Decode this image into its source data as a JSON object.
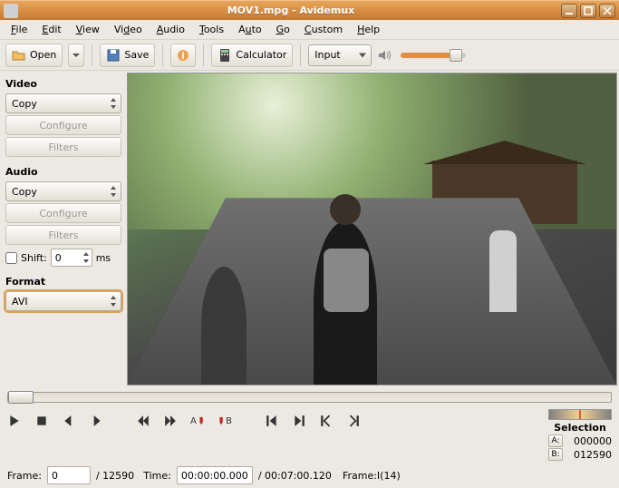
{
  "titlebar": {
    "title": "MOV1.mpg - Avidemux"
  },
  "menu": {
    "file": "File",
    "edit": "Edit",
    "view": "View",
    "video": "Video",
    "audio": "Audio",
    "tools": "Tools",
    "auto": "Auto",
    "go": "Go",
    "custom": "Custom",
    "help": "Help"
  },
  "toolbar": {
    "open": "Open",
    "save": "Save",
    "calculator": "Calculator",
    "input": "Input"
  },
  "sidebar": {
    "video_h": "Video",
    "video_codec": "Copy",
    "video_configure": "Configure",
    "video_filters": "Filters",
    "audio_h": "Audio",
    "audio_codec": "Copy",
    "audio_configure": "Configure",
    "audio_filters": "Filters",
    "shift_label": "Shift:",
    "shift_value": "0",
    "shift_unit": "ms",
    "format_h": "Format",
    "format": "AVI"
  },
  "selection": {
    "heading": "Selection",
    "a_label": "A:",
    "a_value": "000000",
    "b_label": "B:",
    "b_value": "012590"
  },
  "status": {
    "frame_label": "Frame:",
    "frame_value": "0",
    "frame_total": "/ 12590",
    "time_label": "Time:",
    "time_value": "00:00:00.000",
    "time_total": "/ 00:07:00.120",
    "frame_type": "Frame:I(14)"
  }
}
